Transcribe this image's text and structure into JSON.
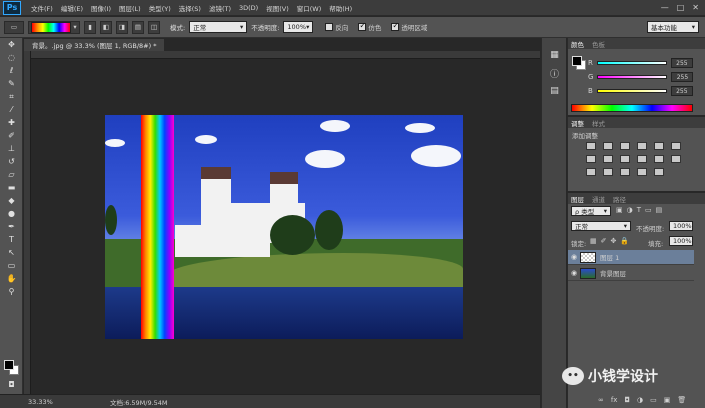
{
  "app": {
    "logo": "Ps"
  },
  "menubar": {
    "items": [
      "文件(F)",
      "编辑(E)",
      "图像(I)",
      "图层(L)",
      "类型(Y)",
      "选择(S)",
      "滤镜(T)",
      "3D(D)",
      "视图(V)",
      "窗口(W)",
      "帮助(H)"
    ],
    "window_controls": [
      "—",
      "□",
      "✕"
    ]
  },
  "options": {
    "mode_label": "模式:",
    "mode_value": "正常",
    "opacity_label": "不透明度:",
    "opacity_value": "100%",
    "reverse_label": "反向",
    "dither_label": "仿色",
    "transparency_label": "透明区域",
    "workspace_value": "基本功能"
  },
  "document": {
    "tab_title": "背景。.jpg @ 33.3% (图层 1, RGB/8#) *",
    "zoom": "33.33%",
    "doc_info": "文档:6.59M/9.54M"
  },
  "color_panel": {
    "tabs": [
      "颜色",
      "色板"
    ],
    "channels": [
      {
        "name": "R",
        "value": "255"
      },
      {
        "name": "G",
        "value": "255"
      },
      {
        "name": "B",
        "value": "255"
      }
    ]
  },
  "adjust_panel": {
    "tabs": [
      "调整",
      "样式"
    ],
    "title": "添加调整"
  },
  "layers_panel": {
    "tabs": [
      "图层",
      "通道",
      "路径"
    ],
    "filter_label": "ρ 类型",
    "blend_mode": "正常",
    "opacity_label": "不透明度:",
    "opacity_value": "100%",
    "lock_label": "锁定:",
    "fill_label": "填充:",
    "fill_value": "100%",
    "layers": [
      {
        "name": "图层 1",
        "selected": true
      },
      {
        "name": "背景图层",
        "selected": false
      }
    ],
    "bottom_icons": [
      "∞",
      "fx",
      "◘",
      "◑",
      "▭",
      "▣",
      "🗑"
    ]
  },
  "watermark": {
    "text": "小钱学设计"
  },
  "colors": {
    "accent": "#31a8ff",
    "selected_layer": "#6b7f9a"
  }
}
